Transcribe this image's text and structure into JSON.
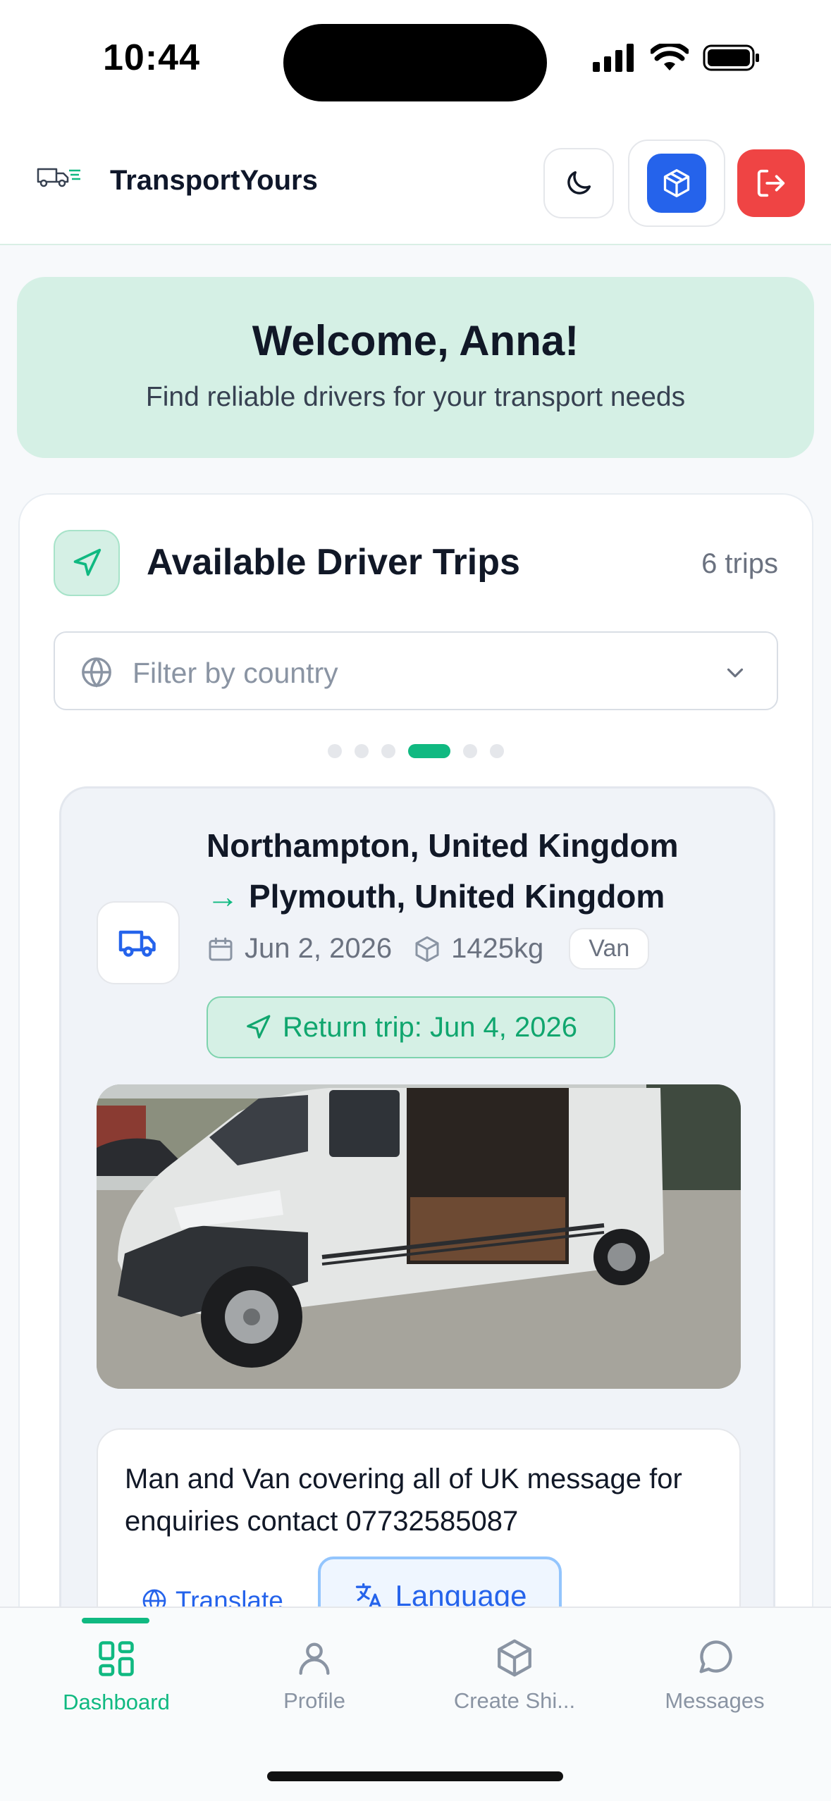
{
  "status_bar": {
    "time": "10:44"
  },
  "header": {
    "brand": "TransportYours"
  },
  "welcome": {
    "title": "Welcome, Anna!",
    "subtitle": "Find reliable drivers for your transport needs"
  },
  "trips": {
    "title": "Available Driver Trips",
    "count": "6 trips",
    "filter_placeholder": "Filter by country",
    "carousel": {
      "total": 6,
      "active_index": 3
    },
    "item": {
      "from": "Northampton, United Kingdom",
      "arrow": "→",
      "to": "Plymouth, United Kingdom",
      "date": "Jun 2, 2026",
      "weight": "1425kg",
      "vehicle": "Van",
      "return_trip": "Return trip: Jun 4, 2026",
      "description": "Man and Van covering all of UK message for enquiries contact 07732585087",
      "translate_label": "Translate",
      "language_label": "Language"
    }
  },
  "bottom_nav": {
    "items": [
      {
        "label": "Dashboard",
        "active": true
      },
      {
        "label": "Profile",
        "active": false
      },
      {
        "label": "Create Shi...",
        "active": false
      },
      {
        "label": "Messages",
        "active": false
      }
    ]
  },
  "colors": {
    "accent": "#10b981",
    "primary_blue": "#2563eb",
    "danger": "#ef4444",
    "welcome_bg": "#d5f0e5"
  }
}
